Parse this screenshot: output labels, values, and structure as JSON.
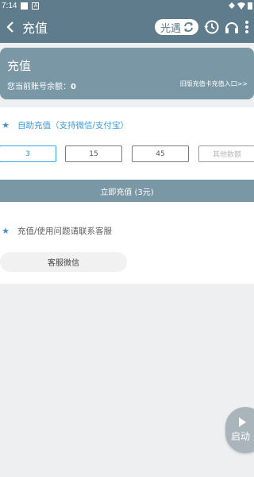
{
  "status_bar": {
    "time": "7:14"
  },
  "app_bar": {
    "title": "充值",
    "guangyu_label": "光遇"
  },
  "account_card": {
    "title": "充值",
    "balance_label": "您当前账号余额：",
    "balance_value": "0",
    "old_entry_link": "旧版充值卡充值入口>>"
  },
  "self_recharge": {
    "section_title": "自助充值（支持微信/支付宝）",
    "amount_options": [
      "3",
      "15",
      "45"
    ],
    "other_amount_placeholder": "其他数额",
    "selected_index": 0,
    "pay_button_label": "立即充值 (3元)"
  },
  "help": {
    "section_title": "充值/使用问题请联系客服",
    "support_button_label": "客服微信"
  },
  "floating_action": {
    "label": "启动"
  },
  "colors": {
    "header": "#5f7c8c",
    "accent": "#3b9be0",
    "card": "#7a97a6"
  }
}
